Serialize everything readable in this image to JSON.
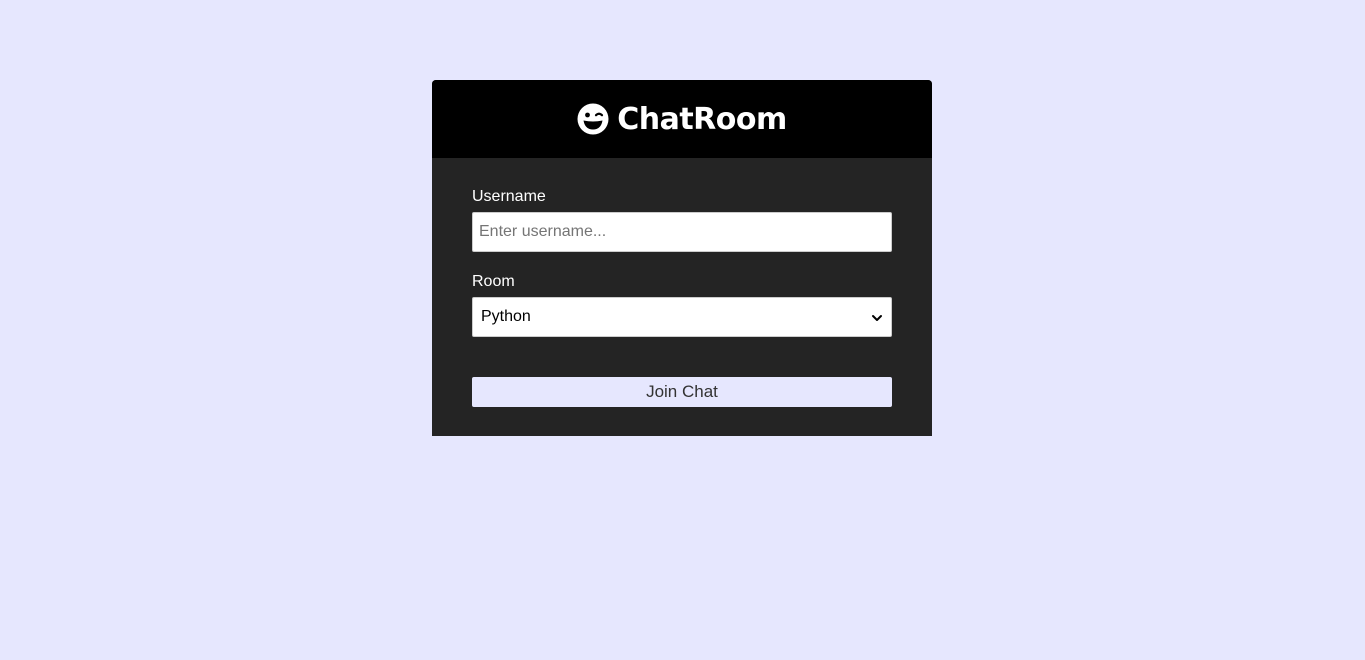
{
  "header": {
    "title": "ChatRoom",
    "logo_icon": "grin-wink-icon"
  },
  "form": {
    "username": {
      "label": "Username",
      "placeholder": "Enter username...",
      "value": ""
    },
    "room": {
      "label": "Room",
      "selected": "Python"
    },
    "submit_label": "Join Chat"
  },
  "colors": {
    "page_background": "#e6e7fe",
    "header_background": "#000000",
    "panel_background": "#242424",
    "button_background": "#e6e7fe"
  }
}
